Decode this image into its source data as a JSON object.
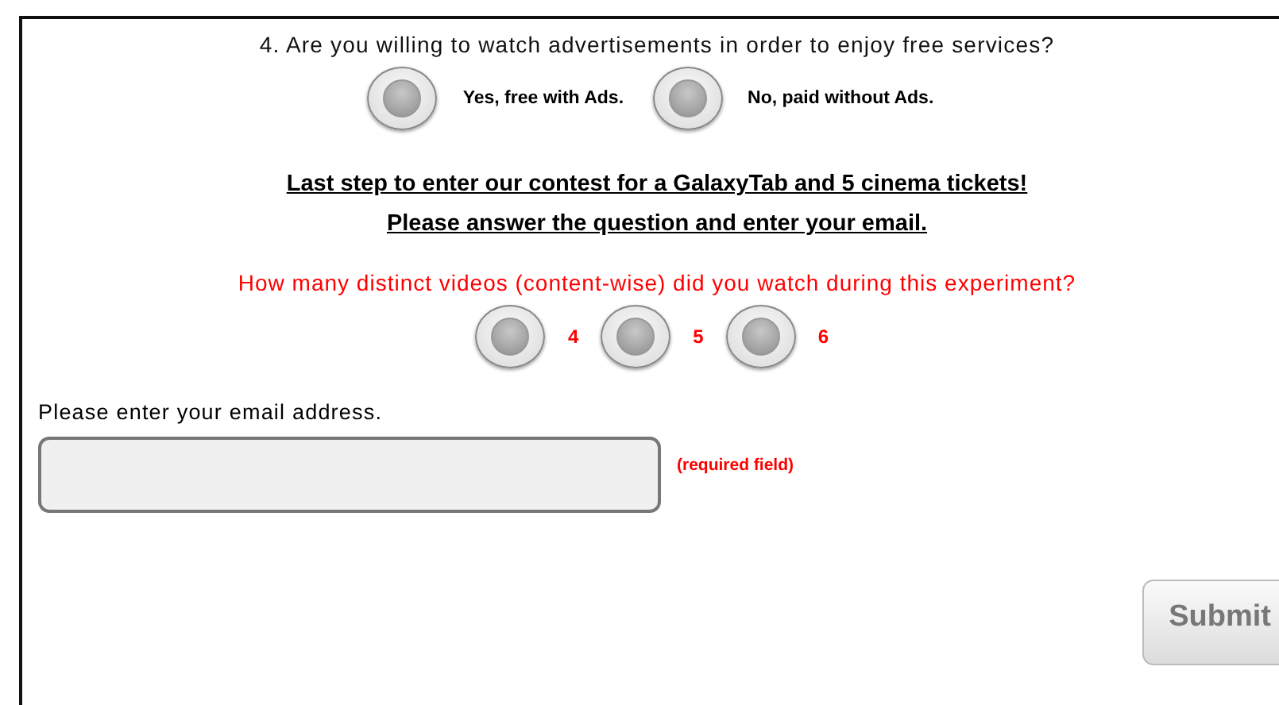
{
  "question_4": {
    "text": "4. Are you willing to watch advertisements in order to enjoy free services?",
    "options": [
      {
        "label": "Yes, free with Ads.",
        "selected": false
      },
      {
        "label": "No, paid without Ads.",
        "selected": false
      }
    ]
  },
  "contest": {
    "lines": [
      "Last step to enter our contest for a GalaxyTab and 5 cinema tickets!",
      "Please answer the question and enter your email."
    ]
  },
  "videos_question": {
    "text": "How many distinct videos (content-wise) did you watch during this experiment?",
    "options": [
      {
        "label": "4",
        "selected": false
      },
      {
        "label": "5",
        "selected": false
      },
      {
        "label": "6",
        "selected": false
      }
    ]
  },
  "email": {
    "label": "Please enter your email address.",
    "required_note": "(required field)"
  },
  "submit_button": "Submit"
}
